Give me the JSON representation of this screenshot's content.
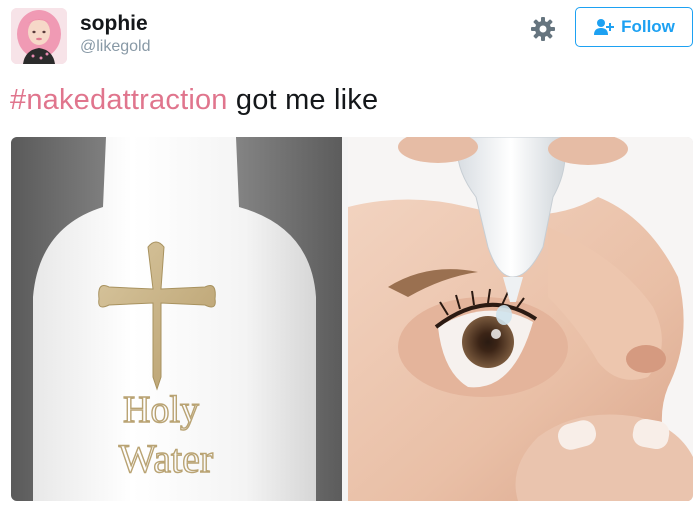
{
  "user": {
    "display_name": "sophie",
    "handle": "@likegold"
  },
  "actions": {
    "follow_label": "Follow"
  },
  "tweet": {
    "hashtag": "#nakedattraction",
    "text_rest": " got me like"
  },
  "media": {
    "left_image": {
      "label_line1": "Holy",
      "label_line2": "Water"
    }
  },
  "colors": {
    "accent": "#1da1f2",
    "hashtag": "#e0758d",
    "muted": "#8899a6",
    "text": "#14171a"
  },
  "icons": [
    "gear-icon",
    "follow-user-icon"
  ]
}
